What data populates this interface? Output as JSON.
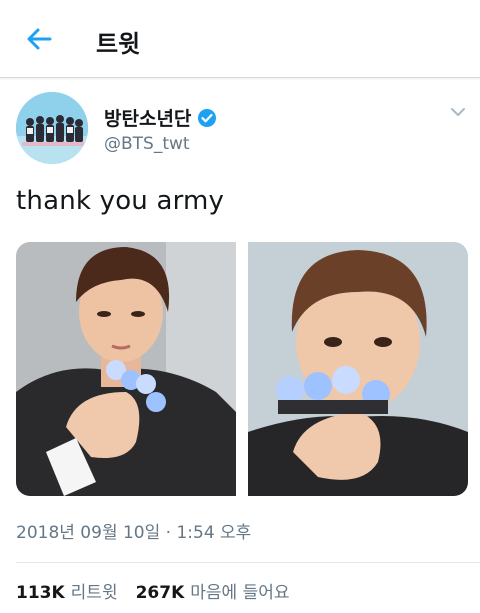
{
  "header": {
    "title": "트윗",
    "back_icon": "arrow-left-icon",
    "accent_color": "#1da1f2"
  },
  "tweet": {
    "display_name": "방탄소년단",
    "handle": "@BTS_twt",
    "verified_icon": "verified-badge-icon",
    "menu_icon": "chevron-down-icon",
    "text": "thank you army",
    "media": [
      {
        "name": "photo-left"
      },
      {
        "name": "photo-right"
      }
    ],
    "timestamp": "2018년 09월 10일 · 1:54 오후",
    "retweets_count": "113K",
    "retweets_label": "리트윗",
    "likes_count": "267K",
    "likes_label": "마음에 들어요"
  }
}
